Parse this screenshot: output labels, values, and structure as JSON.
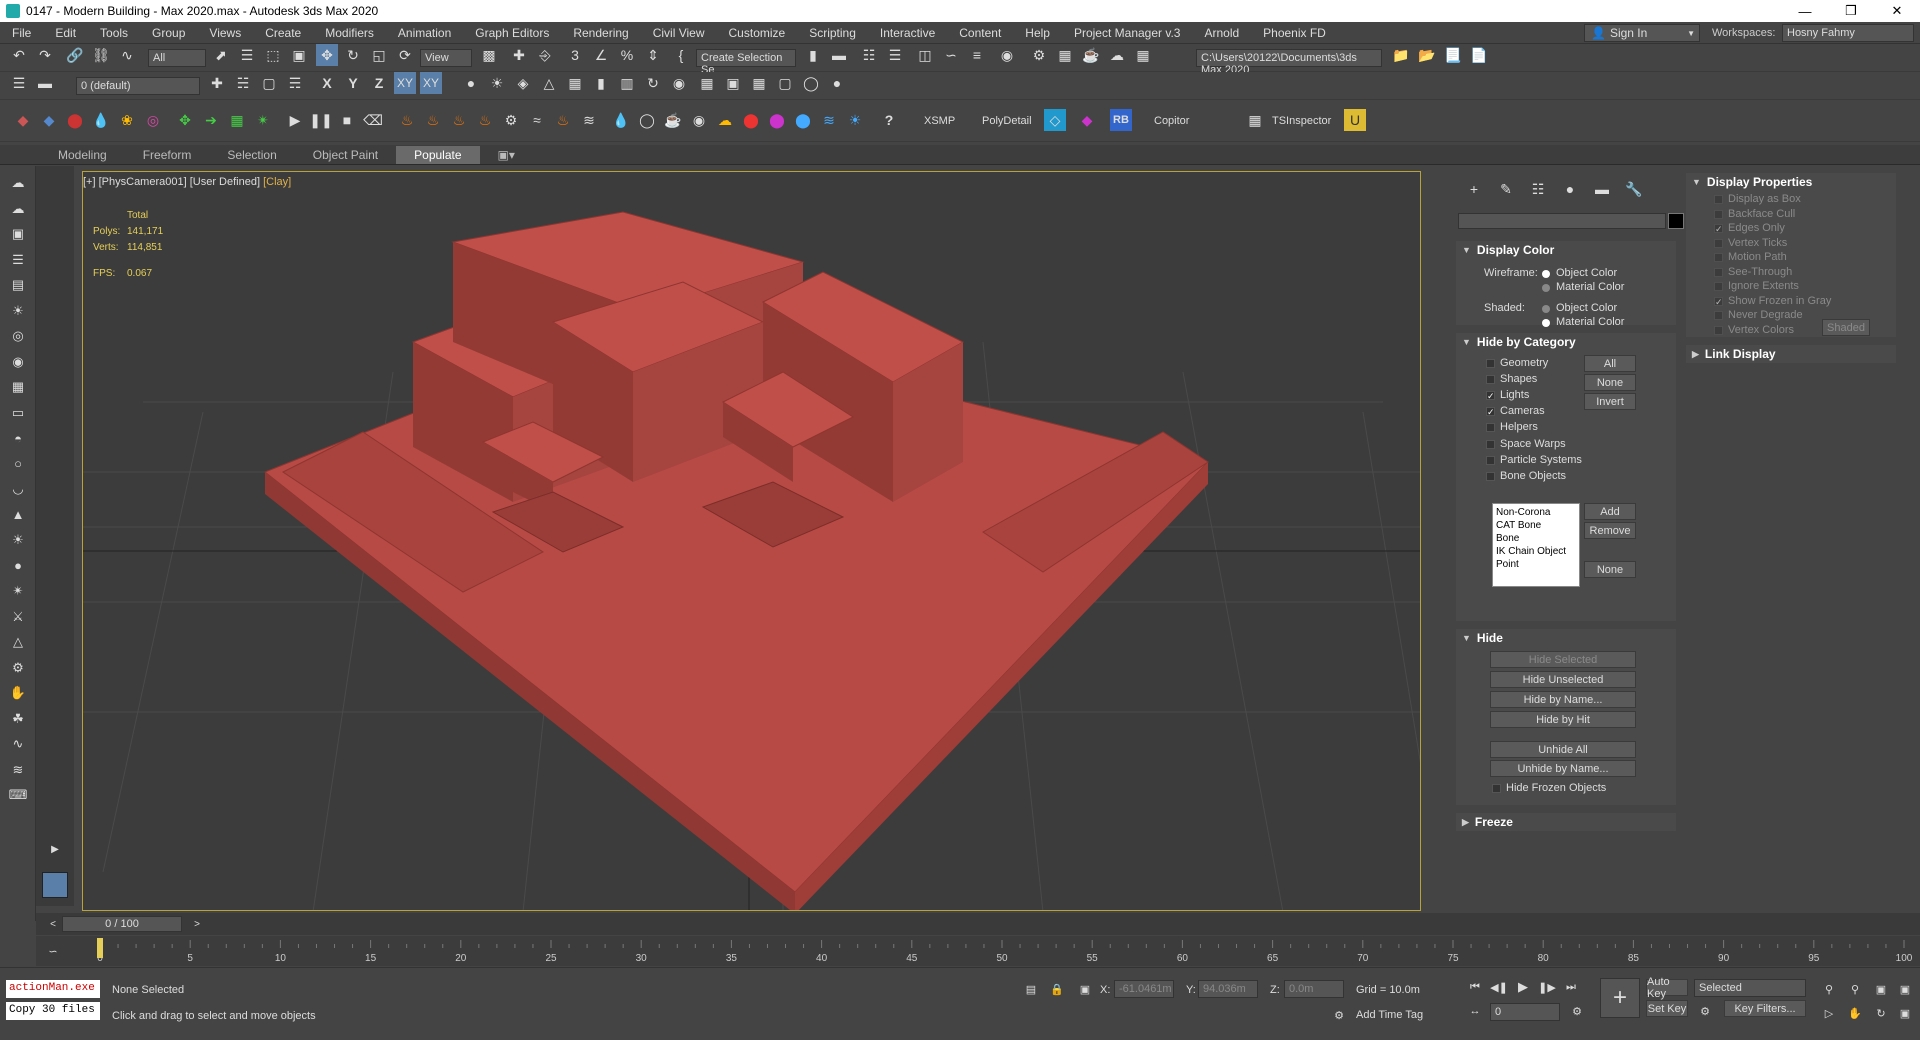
{
  "window": {
    "title": "0147 - Modern Building - Max 2020.max - Autodesk 3ds Max 2020",
    "min": "—",
    "max": "❒",
    "close": "✕"
  },
  "menu": [
    "File",
    "Edit",
    "Tools",
    "Group",
    "Views",
    "Create",
    "Modifiers",
    "Animation",
    "Graph Editors",
    "Rendering",
    "Civil View",
    "Customize",
    "Scripting",
    "Interactive",
    "Content",
    "Help",
    "Project Manager v.3",
    "Arnold",
    "Phoenix FD"
  ],
  "account": {
    "sign_in": "Sign In",
    "workspaces_label": "Workspaces:",
    "workspace": "Hosny Fahmy"
  },
  "toolbar1": {
    "selection_filter": "All",
    "ref_coord": "View",
    "named_selection": "Create Selection Se",
    "project_path": "C:\\Users\\20122\\Documents\\3ds Max 2020"
  },
  "toolbar2": {
    "layer": "0 (default)",
    "axes": [
      "X",
      "Y",
      "Z",
      "XY",
      "XY"
    ]
  },
  "toolbar3": {
    "labels": [
      "XSMP",
      "PolyDetail",
      "RB",
      "Copitor",
      "TSInspector"
    ]
  },
  "ribbon_tabs": [
    "Modeling",
    "Freeform",
    "Selection",
    "Object Paint",
    "Populate"
  ],
  "ribbon_active": "Populate",
  "viewport": {
    "label_plus": "[+]",
    "label_cam": "[PhysCamera001]",
    "label_mode": "[User Defined]",
    "label_shade": "[Clay]",
    "stats": {
      "total_label": "Total",
      "polys_label": "Polys:",
      "polys": "141,171",
      "verts_label": "Verts:",
      "verts": "114,851",
      "fps_label": "FPS:",
      "fps": "0.067"
    }
  },
  "display_panel": {
    "display_color": {
      "title": "Display Color",
      "wireframe_label": "Wireframe:",
      "shaded_label": "Shaded:",
      "object_color": "Object Color",
      "material_color": "Material Color"
    },
    "hide_by_category": {
      "title": "Hide by Category",
      "items": [
        {
          "label": "Geometry",
          "checked": false
        },
        {
          "label": "Shapes",
          "checked": false
        },
        {
          "label": "Lights",
          "checked": true
        },
        {
          "label": "Cameras",
          "checked": true
        },
        {
          "label": "Helpers",
          "checked": false
        },
        {
          "label": "Space Warps",
          "checked": false
        },
        {
          "label": "Particle Systems",
          "checked": false
        },
        {
          "label": "Bone Objects",
          "checked": false
        }
      ],
      "btn_all": "All",
      "btn_none": "None",
      "btn_invert": "Invert",
      "list": [
        "Non-Corona",
        "CAT Bone",
        "Bone",
        "IK Chain Object",
        "Point"
      ],
      "btn_add": "Add",
      "btn_remove": "Remove",
      "btn_none2": "None"
    },
    "hide": {
      "title": "Hide",
      "buttons": [
        "Hide Selected",
        "Hide Unselected",
        "Hide by Name...",
        "Hide by Hit",
        "Unhide All",
        "Unhide by Name..."
      ],
      "hide_frozen": "Hide Frozen Objects"
    },
    "freeze": {
      "title": "Freeze"
    },
    "display_properties": {
      "title": "Display Properties",
      "items": [
        {
          "label": "Display as Box",
          "checked": false
        },
        {
          "label": "Backface Cull",
          "checked": false
        },
        {
          "label": "Edges Only",
          "checked": true
        },
        {
          "label": "Vertex Ticks",
          "checked": false
        },
        {
          "label": "Motion Path",
          "checked": false
        },
        {
          "label": "See-Through",
          "checked": false
        },
        {
          "label": "Ignore Extents",
          "checked": false
        },
        {
          "label": "Show Frozen in Gray",
          "checked": true
        },
        {
          "label": "Never Degrade",
          "checked": false
        },
        {
          "label": "Vertex Colors",
          "checked": false
        }
      ],
      "shaded_btn": "Shaded"
    },
    "link_display": {
      "title": "Link Display"
    }
  },
  "timeline": {
    "frame": "0 / 100",
    "ticks": [
      "0",
      "5",
      "10",
      "15",
      "20",
      "25",
      "30",
      "35",
      "40",
      "45",
      "50",
      "55",
      "60",
      "65",
      "70",
      "75",
      "80",
      "85",
      "90",
      "95",
      "100"
    ]
  },
  "status": {
    "maxscript1": "actionMan.exe",
    "maxscript2": "Copy 30 files",
    "selection": "None Selected",
    "prompt": "Click and drag to select and move objects",
    "x_label": "X:",
    "x": "-61.0461m",
    "y_label": "Y:",
    "y": "94.036m",
    "z_label": "Z:",
    "z": "0.0m",
    "grid": "Grid = 10.0m",
    "add_time_tag": "Add Time Tag",
    "auto_key": "Auto Key",
    "set_key": "Set Key",
    "key_mode": "Selected",
    "key_filters": "Key Filters...",
    "frame_field": "0"
  },
  "colors": {
    "model": "#b84a45",
    "accent": "#b8a23a",
    "stats": "#e6cf58"
  }
}
